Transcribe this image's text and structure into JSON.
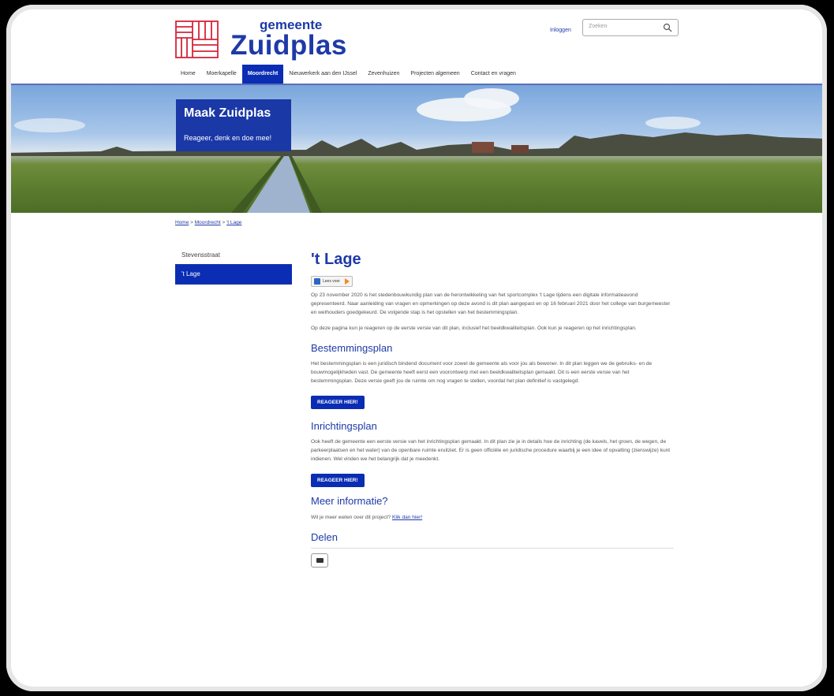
{
  "header": {
    "logo_small": "gemeente",
    "logo_big": "Zuidplas",
    "login": "Inloggen",
    "search_placeholder": "Zoeken"
  },
  "nav": [
    "Home",
    "Moerkapelle",
    "Moordrecht",
    "Nieuwerkerk aan den IJssel",
    "Zevenhuizen",
    "Projecten algemeen",
    "Contact en vragen"
  ],
  "nav_active": "Moordrecht",
  "banner": {
    "title": "Maak Zuidplas",
    "subtitle": "Reageer, denk en doe mee!"
  },
  "breadcrumb": {
    "home": "Home",
    "sep1": " > ",
    "moordrecht": "Moordrecht",
    "sep2": " > ",
    "current": "'t Lage"
  },
  "sidebar": {
    "items": [
      {
        "label": "Stevensstraat"
      },
      {
        "label": "'t Lage"
      }
    ]
  },
  "main": {
    "title": "'t Lage",
    "read_label": "Lees voor",
    "intro_1": "Op 23 november 2020 is het stedenbouwkundig plan van de herontwikkeling van het sportcomplex 't Lage tijdens een digitale informatieavond gepresenteerd. Naar aanleiding van vragen en opmerkingen op deze avond is dit plan aangepast en op 16 februari 2021 door het college van burgemeester en wethouders goedgekeurd. De volgende stap is het opstellen van het bestemmingsplan.",
    "intro_2": "Op deze pagina kun je reageren op de eerste versie van dit plan, inclusief het beeldkwaliteitsplan. Ook kun je reageren op het inrichtingsplan.",
    "h_bestemmingsplan": "Bestemmingsplan",
    "p_bestemmingsplan": "Het bestemmingsplan is een juridisch bindend document voor zowel de gemeente als voor jou als bewoner. In dit plan leggen we de gebruiks- en de bouwmogelijkheden vast. De gemeente heeft eerst een voorontwerp met een beeldkwaliteitsplan gemaakt. Dit is een eerste versie van het bestemmingsplan. Deze versie geeft jou de ruimte om nog vragen te stellen, voordat het plan definitief is vastgelegd.",
    "btn_1": "REAGEER HIER!",
    "h_inrichtingsplan": "Inrichtingsplan",
    "p_inrichtingsplan": "Ook heeft de gemeente een eerste versie van het inrichtingsplan gemaakt. In dit plan zie je in details hoe de inrichting (de kavels, het groen, de wegen, de parkeerplaatsen en het water) van de openbare ruimte eruitziet. Er is geen officiële en juridische procedure waarbij je een idee of opvatting (zienswijze) kunt indienen. Wel vinden we het belangrijk dat je meedenkt.",
    "btn_2": "REAGEER HIER!",
    "h_meer": "Meer informatie?",
    "p_meer": "Wil je meer weten over dit project? ",
    "link_meer": "Klik dan hier!",
    "h_delen": "Delen"
  },
  "colors": {
    "brand_blue": "#1e3aa8",
    "nav_active": "#0a2db3",
    "logo_red": "#d6243a"
  }
}
